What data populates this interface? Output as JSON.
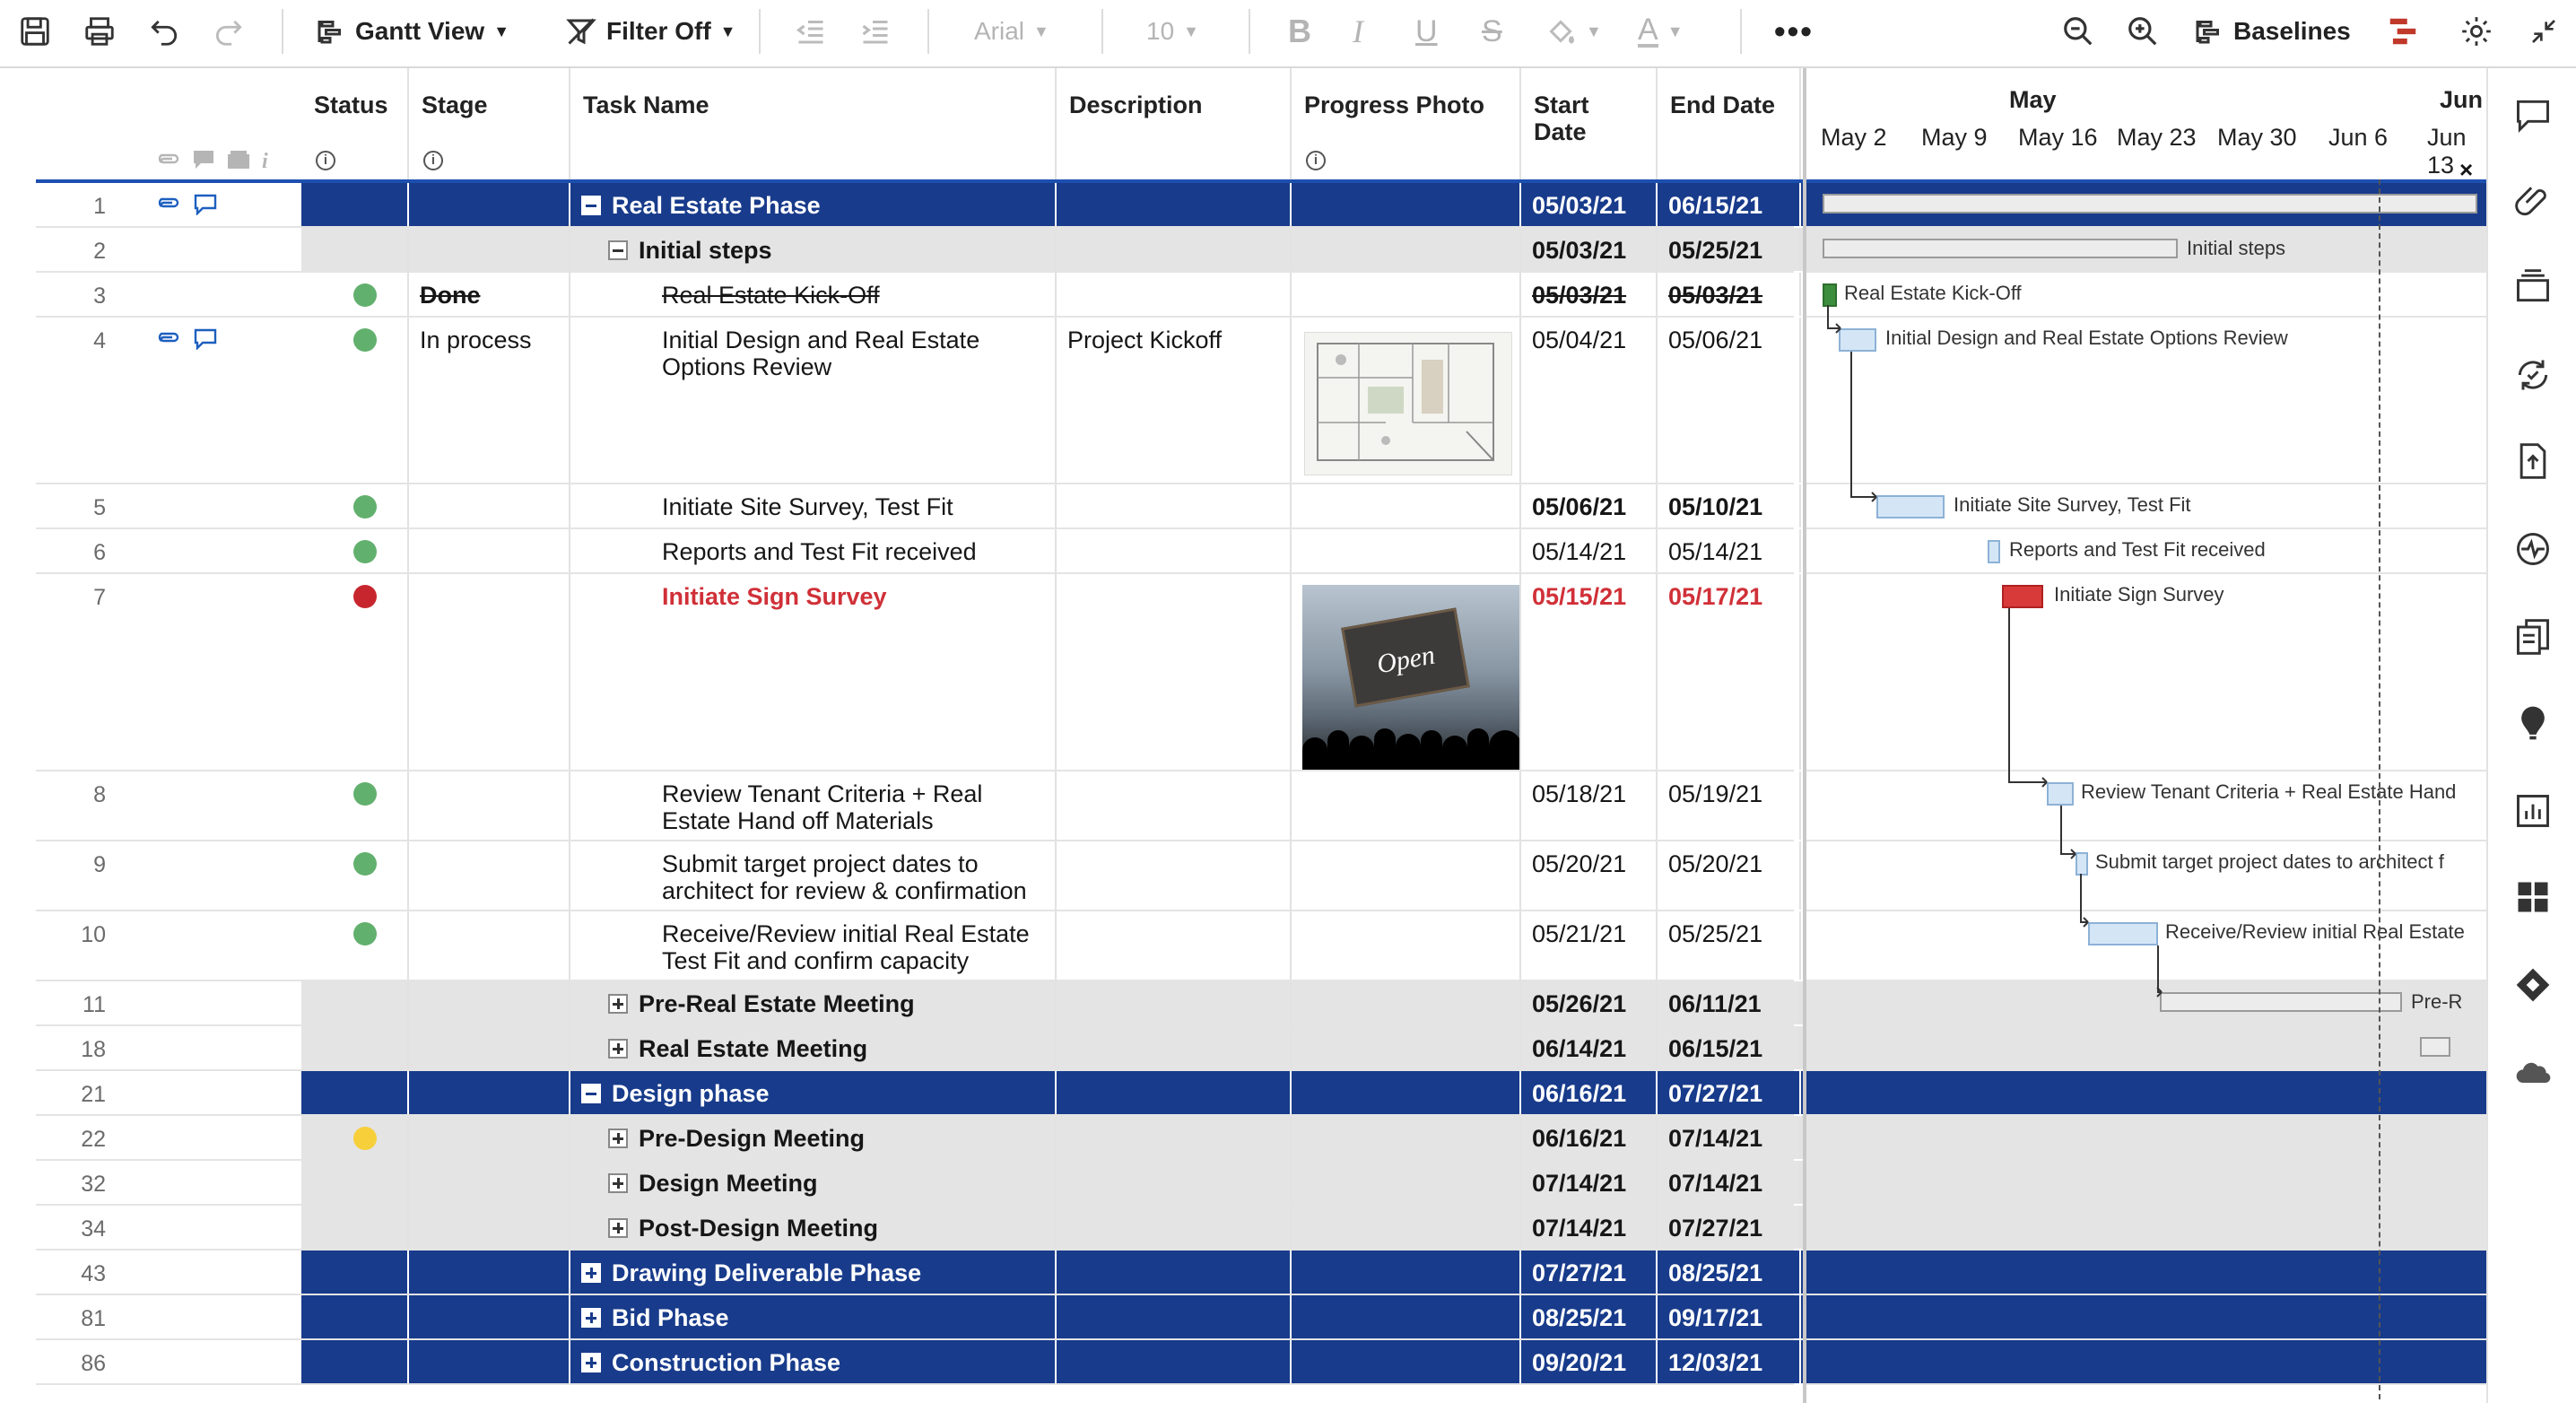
{
  "toolbar": {
    "view_label": "Gantt View",
    "filter_label": "Filter Off",
    "font_name": "Arial",
    "font_size": "10",
    "baselines_label": "Baselines"
  },
  "columns": {
    "status": "Status",
    "stage": "Stage",
    "task": "Task Name",
    "description": "Description",
    "photo": "Progress Photo",
    "start": "Start Date",
    "end": "End Date"
  },
  "rows": [
    {
      "num": "1",
      "kind": "phase",
      "task": "Real Estate Phase",
      "start": "05/03/21",
      "end": "06/15/21"
    },
    {
      "num": "2",
      "kind": "sub",
      "task": "Initial steps",
      "start": "05/03/21",
      "end": "05/25/21"
    },
    {
      "num": "3",
      "kind": "task",
      "status": "green",
      "stage": "Done",
      "task": "Real Estate Kick-Off",
      "start": "05/03/21",
      "end": "05/03/21"
    },
    {
      "num": "4",
      "kind": "task",
      "status": "green",
      "stage": "In process",
      "task": "Initial Design and Real Estate Options Review",
      "description": "Project Kickoff",
      "start": "05/04/21",
      "end": "05/06/21"
    },
    {
      "num": "5",
      "kind": "task",
      "status": "green",
      "task": "Initiate Site Survey, Test Fit",
      "start": "05/06/21",
      "end": "05/10/21"
    },
    {
      "num": "6",
      "kind": "task",
      "status": "green",
      "task": "Reports and Test Fit received",
      "start": "05/14/21",
      "end": "05/14/21"
    },
    {
      "num": "7",
      "kind": "task",
      "status": "red",
      "task": "Initiate Sign Survey",
      "start": "05/15/21",
      "end": "05/17/21"
    },
    {
      "num": "8",
      "kind": "task",
      "status": "green",
      "task": "Review Tenant Criteria + Real Estate Hand off Materials",
      "start": "05/18/21",
      "end": "05/19/21"
    },
    {
      "num": "9",
      "kind": "task",
      "status": "green",
      "task": "Submit target project dates to architect for review & confirmation",
      "start": "05/20/21",
      "end": "05/20/21"
    },
    {
      "num": "10",
      "kind": "task",
      "status": "green",
      "task": "Receive/Review initial Real Estate Test Fit and confirm capacity",
      "start": "05/21/21",
      "end": "05/25/21"
    },
    {
      "num": "11",
      "kind": "sub",
      "task": "Pre-Real Estate Meeting",
      "start": "05/26/21",
      "end": "06/11/21"
    },
    {
      "num": "18",
      "kind": "sub",
      "task": "Real Estate Meeting",
      "start": "06/14/21",
      "end": "06/15/21"
    },
    {
      "num": "21",
      "kind": "phase",
      "task": "Design phase",
      "start": "06/16/21",
      "end": "07/27/21"
    },
    {
      "num": "22",
      "kind": "sub",
      "status": "yellow",
      "task": "Pre-Design Meeting",
      "start": "06/16/21",
      "end": "07/14/21"
    },
    {
      "num": "32",
      "kind": "sub",
      "task": "Design Meeting",
      "start": "07/14/21",
      "end": "07/14/21"
    },
    {
      "num": "34",
      "kind": "sub",
      "task": "Post-Design Meeting",
      "start": "07/14/21",
      "end": "07/27/21"
    },
    {
      "num": "43",
      "kind": "phase",
      "task": "Drawing Deliverable Phase",
      "start": "07/27/21",
      "end": "08/25/21"
    },
    {
      "num": "81",
      "kind": "phase",
      "task": "Bid Phase",
      "start": "08/25/21",
      "end": "09/17/21"
    },
    {
      "num": "86",
      "kind": "phase",
      "task": "Construction Phase",
      "start": "09/20/21",
      "end": "12/03/21"
    }
  ],
  "gantt": {
    "months": [
      "May",
      "Jun"
    ],
    "weeks": [
      "May 2",
      "May 9",
      "May 16",
      "May 23",
      "May 30",
      "Jun 6",
      "Jun 13"
    ],
    "labels": {
      "initial_steps": "Initial steps",
      "kickoff": "Real Estate Kick-Off",
      "design_review": "Initial Design and Real Estate Options Review",
      "site_survey": "Initiate Site Survey, Test Fit",
      "reports": "Reports and Test Fit received",
      "sign_survey": "Initiate Sign Survey",
      "tenant": "Review Tenant Criteria + Real Estate Hand",
      "submit": "Submit target project dates to architect f",
      "receive": "Receive/Review initial Real Estate",
      "pre_re": "Pre-R"
    },
    "close_label": "×"
  },
  "photo": {
    "sign_text": "Open"
  }
}
